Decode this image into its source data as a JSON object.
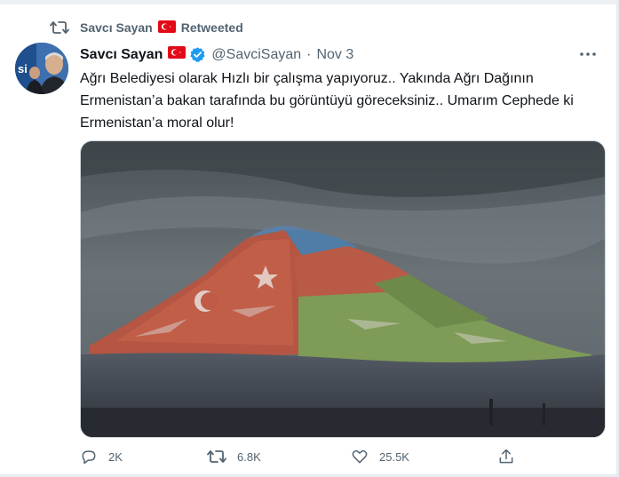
{
  "retweet_banner": {
    "user": "Savcı Sayan",
    "label": "Retweeted"
  },
  "tweet": {
    "author_name": "Savcı Sayan",
    "handle": "@SavciSayan",
    "separator": "·",
    "date": "Nov 3",
    "text": "Ağrı Belediyesi olarak Hızlı bir çalışma yapıyoruz.. Yakında Ağrı Dağının Ermenistan’a bakan tarafında bu görüntüyü göreceksiniz.. Umarım Cephede ki Ermenistan’a moral olur!"
  },
  "actions": {
    "replies": "2K",
    "retweets": "6.8K",
    "likes": "25.5K"
  },
  "colors": {
    "secondary_text": "#536471",
    "verified_blue": "#1d9bf0",
    "turkey_red": "#e30a17"
  },
  "icons": {
    "retweet_banner": "retweet-icon",
    "flag": "turkey-flag-icon",
    "verified": "verified-badge-icon",
    "more": "more-dots-icon",
    "reply": "reply-icon",
    "retweet": "retweet-icon",
    "like": "heart-icon",
    "share": "share-icon"
  }
}
